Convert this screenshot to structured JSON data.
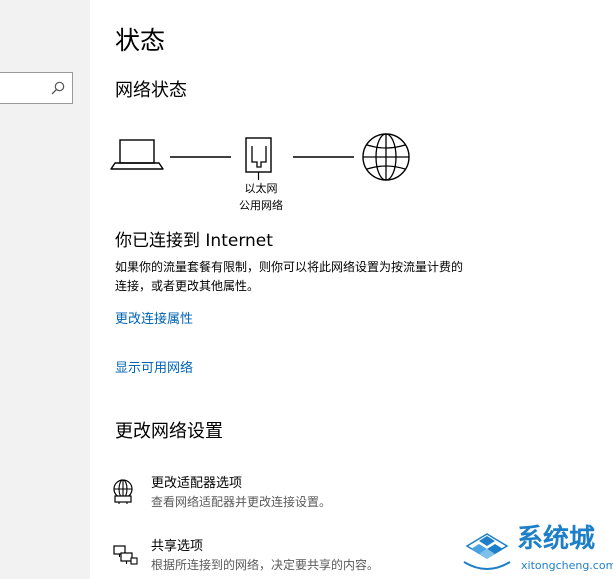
{
  "page": {
    "title": "状态"
  },
  "network_status": {
    "section_title": "网络状态",
    "adapter_name": "以太网",
    "network_kind": "公用网络",
    "connected_heading": "你已连接到 Internet",
    "metered_line1": "如果你的流量套餐有限制，则你可以将此网络设置为按流量计费的",
    "metered_line2": "连接，或者更改其他属性。",
    "change_properties_link": "更改连接属性",
    "show_networks_link": "显示可用网络"
  },
  "change_settings": {
    "section_title": "更改网络设置",
    "items": [
      {
        "title": "更改适配器选项",
        "description": "查看网络适配器并更改连接设置。",
        "icon": "network-adapter-icon"
      },
      {
        "title": "共享选项",
        "description": "根据所连接到的网络，决定要共享的内容。",
        "icon": "sharing-options-icon"
      }
    ]
  },
  "watermark": {
    "brand": "系统城",
    "site": "xitongcheng.com"
  },
  "colors": {
    "link": "#0063b1",
    "nav_background": "#f2f2f2",
    "watermark": "#1e7fc9",
    "description": "#5a5a5a"
  }
}
